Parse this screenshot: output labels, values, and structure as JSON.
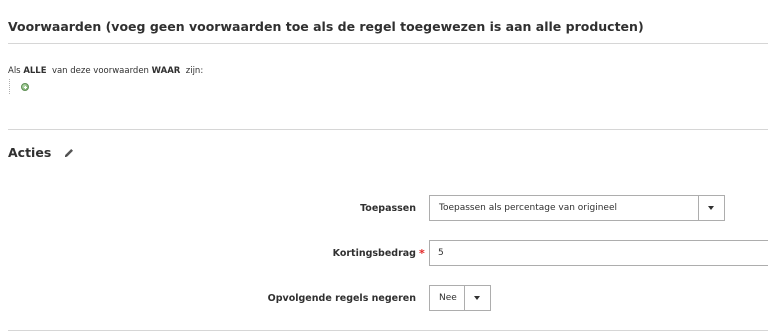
{
  "conditions": {
    "title": "Voorwaarden (voeg geen voorwaarden toe als de regel toegewezen is aan alle producten)",
    "rule_prefix": "Als",
    "aggregator": "ALLE",
    "rule_middle": "van deze voorwaarden",
    "value": "WAAR",
    "rule_suffix": "zijn:",
    "add_icon": "add-condition-icon"
  },
  "actions": {
    "title": "Acties",
    "edit_icon": "pencil-icon",
    "apply": {
      "label": "Toepassen",
      "selected": "Toepassen als percentage van origineel"
    },
    "discount_amount": {
      "label": "Kortingsbedrag",
      "required_mark": "*",
      "value": "5"
    },
    "stop_rules": {
      "label": "Opvolgende regels negeren",
      "selected": "Nee"
    }
  },
  "colors": {
    "required": "#e22626",
    "border": "#adadad",
    "divider": "#d6d6d6",
    "add_icon": "#6fa362"
  }
}
